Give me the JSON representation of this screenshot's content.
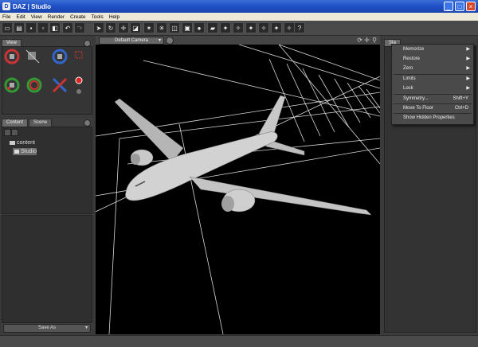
{
  "window": {
    "title": "DAZ | Studio",
    "icon": "daz-logo-icon"
  },
  "menu": [
    "File",
    "Edit",
    "View",
    "Render",
    "Create",
    "Tools",
    "Help"
  ],
  "left_top": {
    "tab": "View"
  },
  "left_bottom": {
    "tabs": [
      "Content",
      "Scene"
    ],
    "tree": [
      "content",
      "Studio"
    ],
    "save_as": "Save As"
  },
  "viewport": {
    "camera": "Default Camera"
  },
  "right_panel": {
    "tab": "Sta"
  },
  "context_menu": {
    "items": [
      {
        "label": "Memorize",
        "submenu": true
      },
      {
        "label": "Restore",
        "submenu": true
      },
      {
        "label": "Zero",
        "submenu": true
      },
      {
        "label": "Limits",
        "submenu": true
      },
      {
        "label": "Lock",
        "submenu": true
      },
      {
        "label": "Symmetry...",
        "shortcut": "Shift+Y"
      },
      {
        "label": "Move To Floor",
        "shortcut": "Ctrl+D"
      },
      {
        "label": "Show Hidden Properties"
      }
    ]
  },
  "colors": {
    "accent": "#1f4fc4",
    "viewport_bg": "#000000",
    "panel_bg": "#3d3d3d"
  }
}
